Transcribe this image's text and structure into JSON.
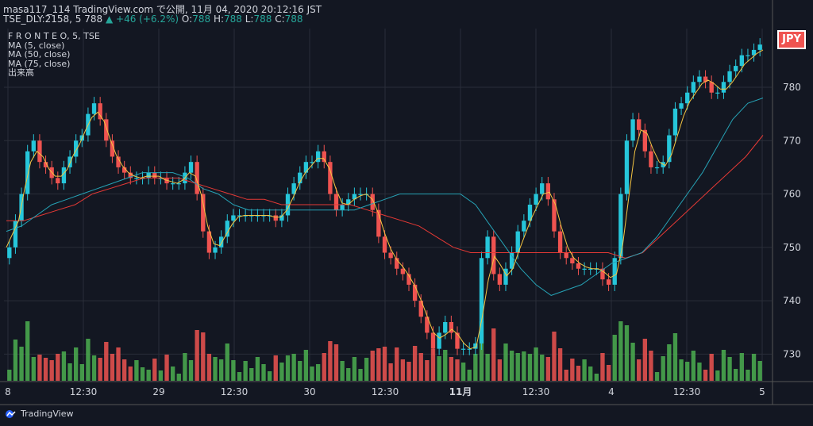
{
  "header": {
    "line1": "masa117_114 TradingView.com で公開, 11月 04, 2020 20:12:16 JST",
    "line2_prefix": "TSE_DLY:2158, 5 788",
    "line2_change": "▲ +46 (+6.2%)",
    "o_label": "O:",
    "o_value": "788",
    "h_label": "H:",
    "h_value": "788",
    "l_label": "L:",
    "l_value": "788",
    "c_label": "C:",
    "c_value": "788"
  },
  "legend": {
    "symbol": "F R O N T E O, 5, TSE",
    "ma5": "MA (5, close)",
    "ma50": "MA (50, close)",
    "ma75": "MA (75, close)",
    "volume": "出来高"
  },
  "currency_badge": "JPY",
  "footer": {
    "brand": "TradingView"
  },
  "colors": {
    "background": "#131722",
    "up": "#26c6da",
    "down": "#ef5350",
    "vol_up": "#4caf50",
    "vol_down": "#ef5350",
    "ma5": "#f5c542",
    "ma50": "#26a2b5",
    "ma75": "#e53935",
    "text": "#d1d4dc"
  },
  "chart_data": {
    "type": "candlestick",
    "title": "F R O N T E O, 5, TSE",
    "y_ticks": [
      730,
      740,
      750,
      760,
      770,
      780
    ],
    "ylim": [
      725,
      791
    ],
    "x_tick_labels": [
      "8",
      "12:30",
      "29",
      "12:30",
      "30",
      "12:30",
      "11月",
      "12:30",
      "4",
      "12:30",
      "5"
    ],
    "bold_x_tick": "11月",
    "last_price": 788,
    "close_series": [
      750,
      755,
      760,
      768,
      770,
      766,
      765,
      763,
      762,
      765,
      767,
      770,
      771,
      775,
      777,
      774,
      770,
      767,
      765,
      764,
      763,
      763,
      763,
      764,
      763,
      763,
      762,
      762,
      762,
      764,
      766,
      760,
      753,
      749,
      750,
      752,
      755,
      756,
      756,
      756,
      756,
      756,
      756,
      756,
      755,
      756,
      760,
      762,
      764,
      766,
      766,
      768,
      766,
      760,
      757,
      758,
      759,
      760,
      760,
      760,
      757,
      752,
      749,
      748,
      746,
      745,
      743,
      740,
      737,
      734,
      731,
      734,
      736,
      734,
      731,
      731,
      731,
      732,
      748,
      752,
      745,
      743,
      746,
      749,
      753,
      755,
      758,
      760,
      762,
      759,
      753,
      749,
      748,
      747,
      746,
      746,
      746,
      746,
      744,
      743,
      748,
      760,
      770,
      774,
      772,
      768,
      765,
      765,
      766,
      771,
      776,
      777,
      779,
      781,
      782,
      781,
      779,
      779,
      781,
      783,
      784,
      786,
      786,
      787,
      788
    ],
    "ma50_series": [
      753,
      754,
      756,
      758,
      759,
      760,
      761,
      762,
      763,
      764,
      764,
      764,
      763,
      761,
      760,
      758,
      757,
      757,
      757,
      757,
      757,
      757,
      757,
      757,
      758,
      759,
      760,
      760,
      760,
      760,
      760,
      758,
      754,
      750,
      746,
      743,
      741,
      742,
      743,
      745,
      747,
      748,
      749,
      752,
      756,
      760,
      764,
      769,
      774,
      777,
      778
    ],
    "ma75_series": [
      755,
      755,
      756,
      757,
      758,
      760,
      761,
      762,
      763,
      763,
      763,
      762,
      761,
      760,
      759,
      759,
      758,
      758,
      758,
      758,
      758,
      757,
      756,
      755,
      754,
      752,
      750,
      749,
      749,
      749,
      749,
      749,
      749,
      749,
      749,
      749,
      748,
      749,
      752,
      755,
      758,
      761,
      764,
      767,
      771
    ],
    "volume_note": "volume bars at bottom (unscaled)"
  }
}
